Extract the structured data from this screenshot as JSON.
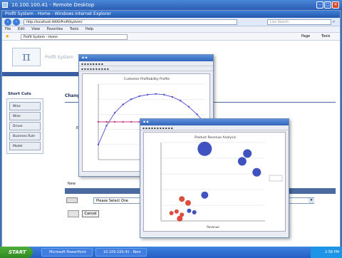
{
  "remote_desktop": {
    "title": "10.100.100.41 - Remote Desktop"
  },
  "browser": {
    "title": "Profit System - Home - Windows Internet Explorer",
    "address": "http://localhost:4000/ProfitSystem/",
    "search_placeholder": "Live Search",
    "menu": [
      "File",
      "Edit",
      "View",
      "Favorites",
      "Tools",
      "Help"
    ],
    "favorite_tab": "Profit System - Home",
    "toolbar_right": "Page",
    "toolbar_tools": "Tools"
  },
  "app": {
    "logo_text": "Profit System",
    "shortcuts_title": "Short Cuts",
    "shortcuts": [
      "Wise Component",
      "Wise",
      "Driver",
      "Business Rule",
      "Model"
    ],
    "main_heading": "Chang",
    "section_label": "Exclu",
    "new_label": "New",
    "select_value": "Please Select One",
    "cancel_label": "Cancel"
  },
  "window1": {
    "chart_data": {
      "type": "line",
      "title": "Customer Profitability Profile",
      "series": [
        {
          "values": [
            0.2,
            0.45,
            0.62,
            0.73,
            0.8,
            0.84,
            0.86,
            0.87,
            0.86,
            0.83,
            0.78,
            0.7,
            0.6,
            0.48
          ]
        },
        {
          "values": [
            0.5,
            0.5,
            0.5,
            0.5,
            0.5,
            0.5,
            0.5,
            0.5,
            0.5,
            0.5,
            0.5,
            0.5,
            0.5,
            0.5
          ]
        }
      ],
      "colors": [
        "#4b4bd0",
        "#c23a8a"
      ]
    }
  },
  "window2": {
    "chart_data": {
      "type": "scatter",
      "title": "Product Revenue Analysis",
      "xlabel": "Revenue",
      "points": [
        {
          "x": 0.42,
          "y": 0.92,
          "r": 10,
          "color": "#2a3fb8"
        },
        {
          "x": 0.83,
          "y": 0.86,
          "r": 6,
          "color": "#2a3fb8"
        },
        {
          "x": 0.78,
          "y": 0.76,
          "r": 6,
          "color": "#2a3fb8"
        },
        {
          "x": 0.92,
          "y": 0.62,
          "r": 6,
          "color": "#2a3fb8"
        },
        {
          "x": 0.42,
          "y": 0.33,
          "r": 5,
          "color": "#2a3fb8"
        },
        {
          "x": 0.2,
          "y": 0.28,
          "r": 4,
          "color": "#d93a2a"
        },
        {
          "x": 0.26,
          "y": 0.23,
          "r": 4,
          "color": "#d93a2a"
        },
        {
          "x": 0.1,
          "y": 0.1,
          "r": 3,
          "color": "#d93a2a"
        },
        {
          "x": 0.15,
          "y": 0.12,
          "r": 3,
          "color": "#d93a2a"
        },
        {
          "x": 0.2,
          "y": 0.08,
          "r": 3,
          "color": "#d93a2a"
        },
        {
          "x": 0.27,
          "y": 0.13,
          "r": 3,
          "color": "#2a3fb8"
        },
        {
          "x": 0.32,
          "y": 0.11,
          "r": 3,
          "color": "#2a3fb8"
        },
        {
          "x": 0.18,
          "y": 0.03,
          "r": 4,
          "color": "#d93a2a"
        }
      ]
    }
  },
  "taskbar": {
    "start_label": "START",
    "items": [
      "Microsoft PowerPoint",
      "10.100.100.41 - Rem"
    ],
    "clock": "2:58 PM"
  }
}
